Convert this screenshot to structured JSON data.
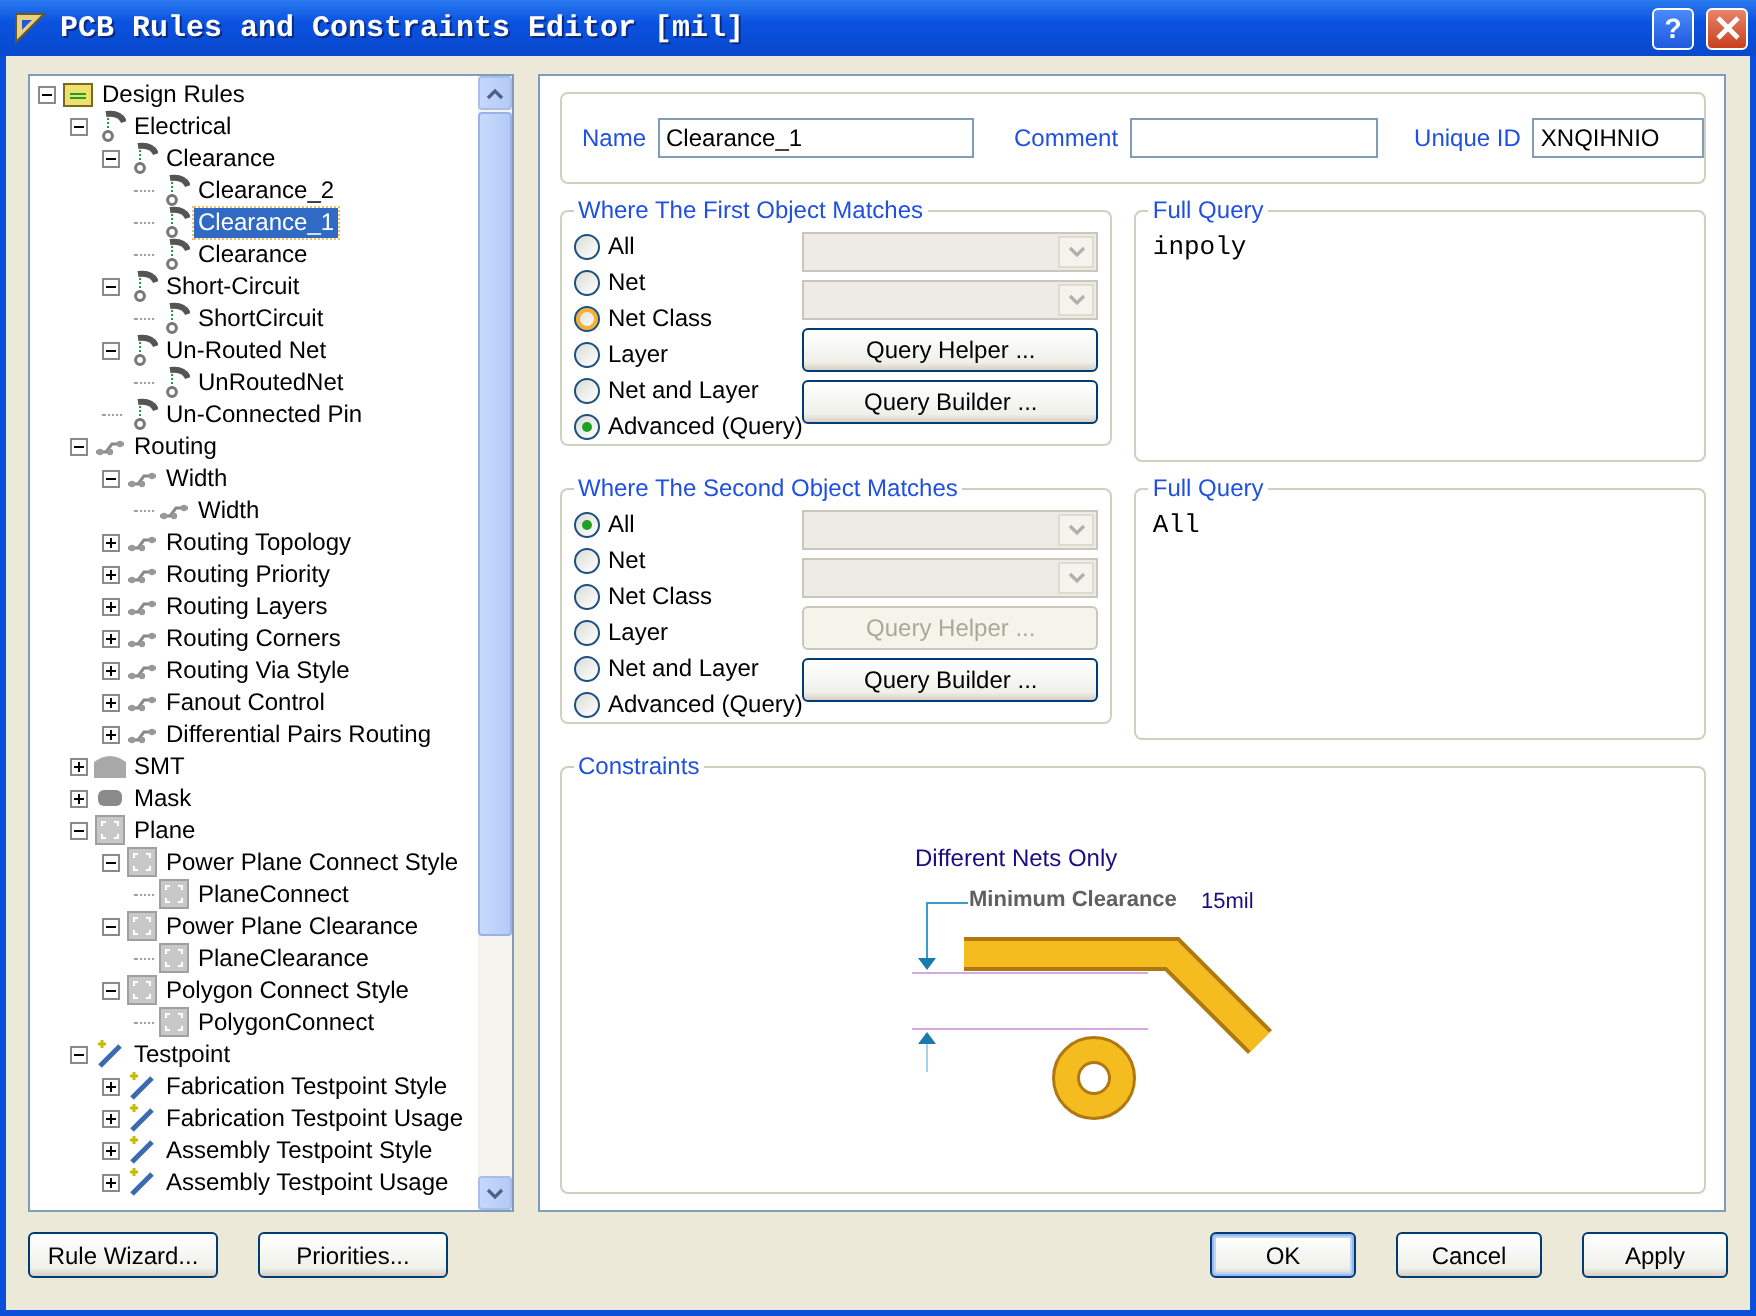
{
  "window": {
    "title": "PCB Rules and Constraints Editor [mil]",
    "help_button": "?"
  },
  "tree": [
    {
      "label": "Design Rules",
      "kind": "folder",
      "expanded": true,
      "selected": false,
      "children": [
        {
          "label": "Electrical",
          "kind": "electrical",
          "expanded": true,
          "selected": false,
          "children": [
            {
              "label": "Clearance",
              "kind": "electrical",
              "expanded": true,
              "selected": false,
              "children": [
                {
                  "label": "Clearance_2",
                  "kind": "electrical",
                  "selected": false
                },
                {
                  "label": "Clearance_1",
                  "kind": "electrical",
                  "selected": true
                },
                {
                  "label": "Clearance",
                  "kind": "electrical",
                  "selected": false
                }
              ]
            },
            {
              "label": "Short-Circuit",
              "kind": "electrical",
              "expanded": true,
              "selected": false,
              "children": [
                {
                  "label": "ShortCircuit",
                  "kind": "electrical",
                  "selected": false
                }
              ]
            },
            {
              "label": "Un-Routed Net",
              "kind": "electrical",
              "expanded": true,
              "selected": false,
              "children": [
                {
                  "label": "UnRoutedNet",
                  "kind": "electrical",
                  "selected": false
                }
              ]
            },
            {
              "label": "Un-Connected Pin",
              "kind": "electrical",
              "selected": false
            }
          ]
        },
        {
          "label": "Routing",
          "kind": "routing",
          "expanded": true,
          "selected": false,
          "children": [
            {
              "label": "Width",
              "kind": "routing",
              "expanded": true,
              "selected": false,
              "children": [
                {
                  "label": "Width",
                  "kind": "routing",
                  "selected": false
                }
              ]
            },
            {
              "label": "Routing Topology",
              "kind": "routing",
              "expanded": false,
              "selected": false
            },
            {
              "label": "Routing Priority",
              "kind": "routing",
              "expanded": false,
              "selected": false
            },
            {
              "label": "Routing Layers",
              "kind": "routing",
              "expanded": false,
              "selected": false
            },
            {
              "label": "Routing Corners",
              "kind": "routing",
              "expanded": false,
              "selected": false
            },
            {
              "label": "Routing Via Style",
              "kind": "routing",
              "expanded": false,
              "selected": false
            },
            {
              "label": "Fanout Control",
              "kind": "routing",
              "expanded": false,
              "selected": false
            },
            {
              "label": "Differential Pairs Routing",
              "kind": "routing",
              "expanded": false,
              "selected": false
            }
          ]
        },
        {
          "label": "SMT",
          "kind": "smt",
          "expanded": false,
          "selected": false
        },
        {
          "label": "Mask",
          "kind": "mask",
          "expanded": false,
          "selected": false
        },
        {
          "label": "Plane",
          "kind": "plane",
          "expanded": true,
          "selected": false,
          "children": [
            {
              "label": "Power Plane Connect Style",
              "kind": "plane",
              "expanded": true,
              "selected": false,
              "children": [
                {
                  "label": "PlaneConnect",
                  "kind": "plane",
                  "selected": false
                }
              ]
            },
            {
              "label": "Power Plane Clearance",
              "kind": "plane",
              "expanded": true,
              "selected": false,
              "children": [
                {
                  "label": "PlaneClearance",
                  "kind": "plane",
                  "selected": false
                }
              ]
            },
            {
              "label": "Polygon Connect Style",
              "kind": "plane",
              "expanded": true,
              "selected": false,
              "children": [
                {
                  "label": "PolygonConnect",
                  "kind": "plane",
                  "selected": false
                }
              ]
            }
          ]
        },
        {
          "label": "Testpoint",
          "kind": "testpoint",
          "expanded": true,
          "selected": false,
          "children": [
            {
              "label": "Fabrication Testpoint Style",
              "kind": "testpoint",
              "expanded": false,
              "selected": false
            },
            {
              "label": "Fabrication Testpoint Usage",
              "kind": "testpoint",
              "expanded": false,
              "selected": false
            },
            {
              "label": "Assembly Testpoint Style",
              "kind": "testpoint",
              "expanded": false,
              "selected": false
            },
            {
              "label": "Assembly Testpoint Usage",
              "kind": "testpoint",
              "expanded": false,
              "selected": false
            }
          ]
        }
      ]
    }
  ],
  "rule": {
    "name_label": "Name",
    "name": "Clearance_1",
    "comment_label": "Comment",
    "unique_id_label": "Unique ID",
    "unique_id": "XNQIHNIO"
  },
  "scopes": [
    {
      "title": "Where The First Object Matches",
      "options": [
        {
          "label": "All",
          "selected": false,
          "hovered": false
        },
        {
          "label": "Net",
          "selected": false,
          "hovered": false
        },
        {
          "label": "Net Class",
          "selected": false,
          "hovered": true
        },
        {
          "label": "Layer",
          "selected": false,
          "hovered": false
        },
        {
          "label": "Net and Layer",
          "selected": false,
          "hovered": false
        },
        {
          "label": "Advanced (Query)",
          "selected": true,
          "hovered": false
        }
      ],
      "buttons": [
        {
          "label": "Query Helper ...",
          "disabled": false
        },
        {
          "label": "Query Builder ...",
          "disabled": false
        }
      ],
      "query_title": "Full Query",
      "query": "inpoly"
    },
    {
      "title": "Where The Second Object Matches",
      "options": [
        {
          "label": "All",
          "selected": true,
          "hovered": false
        },
        {
          "label": "Net",
          "selected": false,
          "hovered": false
        },
        {
          "label": "Net Class",
          "selected": false,
          "hovered": false
        },
        {
          "label": "Layer",
          "selected": false,
          "hovered": false
        },
        {
          "label": "Net and Layer",
          "selected": false,
          "hovered": false
        },
        {
          "label": "Advanced (Query)",
          "selected": false,
          "hovered": false
        }
      ],
      "buttons": [
        {
          "label": "Query Helper ...",
          "disabled": true
        },
        {
          "label": "Query Builder ...",
          "disabled": false
        }
      ],
      "query_title": "Full Query",
      "query": "All"
    }
  ],
  "constraints": {
    "title": "Constraints",
    "scope_label": "Different Nets Only",
    "clearance_label": "Minimum Clearance",
    "clearance_value": "15mil"
  },
  "footer": {
    "left_buttons": [
      "Rule Wizard...",
      "Priorities..."
    ],
    "right_buttons": [
      {
        "label": "OK",
        "default": true
      },
      {
        "label": "Cancel",
        "default": false
      },
      {
        "label": "Apply",
        "default": false
      }
    ]
  }
}
